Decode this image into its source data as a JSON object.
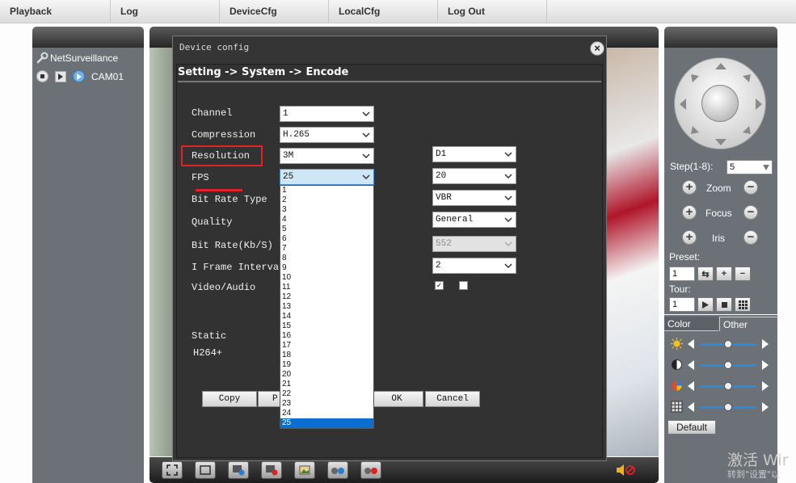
{
  "menu": [
    "Playback",
    "Log",
    "DeviceCfg",
    "LocalCfg",
    "Log Out"
  ],
  "tree": {
    "root": "NetSurveillance",
    "camera": "CAM01"
  },
  "dialog": {
    "title": "Device config",
    "breadcrumb": "Setting -> System -> Encode",
    "labels": {
      "channel": "Channel",
      "compression": "Compression",
      "resolution": "Resolution",
      "fps": "FPS",
      "bitrate_type": "Bit Rate Type",
      "quality": "Quality",
      "bitrate": "Bit Rate(Kb/S)",
      "iframe": "I Frame Interval",
      "video_audio": "Video/Audio",
      "static": "Static",
      "h264plus": "H264+"
    },
    "main_stream": {
      "channel": "1",
      "compression": "H.265",
      "resolution": "3M",
      "fps": "25"
    },
    "extra_stream": {
      "resolution": "D1",
      "fps": "20",
      "bitrate_type": "VBR",
      "quality": "General",
      "bitrate": "552",
      "iframe": "2"
    },
    "extra_video_checked": "✓",
    "fps_options": [
      "1",
      "2",
      "3",
      "4",
      "5",
      "6",
      "7",
      "8",
      "9",
      "10",
      "11",
      "12",
      "13",
      "14",
      "15",
      "16",
      "17",
      "18",
      "19",
      "20",
      "21",
      "22",
      "23",
      "24",
      "25"
    ],
    "fps_selected_index": 24,
    "buttons": {
      "copy": "Copy",
      "paste": "P",
      "ok": "OK",
      "cancel": "Cancel"
    },
    "highlight_color": "#e0232a"
  },
  "ptz": {
    "step_label": "Step(1-8):",
    "step_value": "5",
    "zoom": "Zoom",
    "focus": "Focus",
    "iris": "Iris",
    "preset_label": "Preset:",
    "preset_value": "1",
    "tour_label": "Tour:",
    "tour_value": "1"
  },
  "color_panel": {
    "tab_color": "Color",
    "tab_other": "Other",
    "default_label": "Default",
    "slider_levels": [
      0.5,
      0.5,
      0.5,
      0.5
    ]
  },
  "watermark": {
    "line1": "激活 Wir",
    "line2": "转到\"设置\"以"
  }
}
